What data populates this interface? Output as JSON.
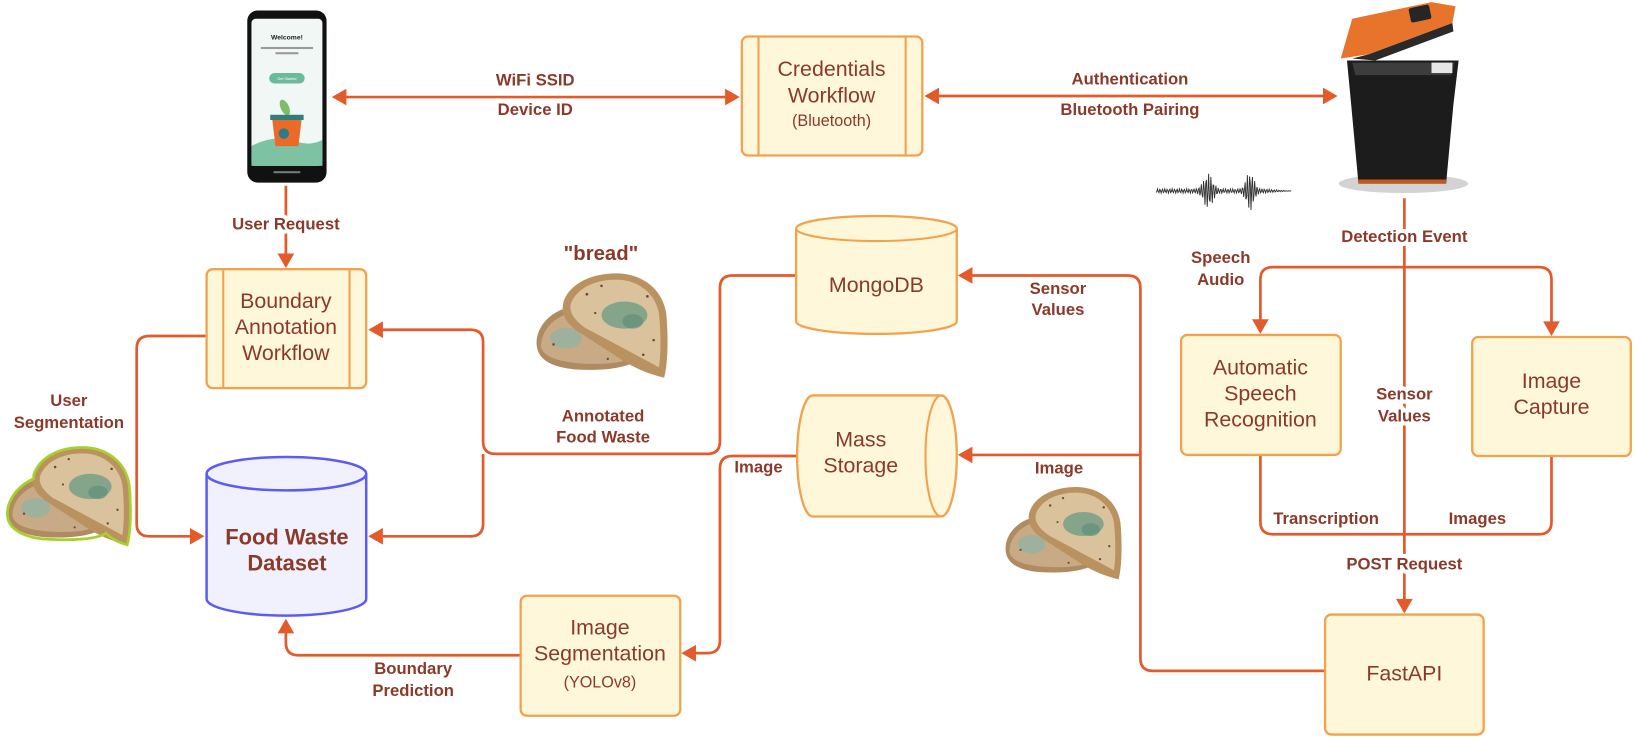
{
  "colors": {
    "connector": "#e35a2b",
    "node_fill": "#fff7d9",
    "node_stroke": "#f3a24c",
    "text": "#8b3a2a",
    "dataset_fill": "#f1f1fd",
    "dataset_stroke": "#5c5cf5"
  },
  "nodes": {
    "credentials_workflow": {
      "shape": "subprocess",
      "lines": [
        "Credentials",
        "Workflow"
      ],
      "subtitle": "(Bluetooth)"
    },
    "boundary_annotation_workflow": {
      "shape": "subprocess",
      "lines": [
        "Boundary",
        "Annotation",
        "Workflow"
      ]
    },
    "food_waste_dataset": {
      "shape": "database",
      "lines": [
        "Food Waste",
        "Dataset"
      ]
    },
    "image_segmentation": {
      "shape": "process",
      "lines": [
        "Image",
        "Segmentation"
      ],
      "subtitle": "(YOLOv8)"
    },
    "mongodb": {
      "shape": "database",
      "lines": [
        "MongoDB"
      ]
    },
    "mass_storage": {
      "shape": "storage",
      "lines": [
        "Mass",
        "Storage"
      ]
    },
    "automatic_speech_recognition": {
      "shape": "process",
      "lines": [
        "Automatic",
        "Speech",
        "Recognition"
      ]
    },
    "image_capture": {
      "shape": "process",
      "lines": [
        "Image",
        "Capture"
      ]
    },
    "fastapi": {
      "shape": "process",
      "lines": [
        "FastAPI"
      ]
    }
  },
  "images": {
    "phone_app": {
      "icon": "smartphone-app",
      "screen_heading": "Welcome!",
      "screen_button": "Get Started"
    },
    "smart_bin": {
      "icon": "smart-bin-device"
    },
    "audio_waveform": {
      "icon": "audio-waveform"
    },
    "annotated_sample": {
      "icon": "moldy-bread-photo",
      "caption": "\"bread\""
    },
    "captured_sample": {
      "icon": "moldy-bread-photo"
    },
    "segmented_sample": {
      "icon": "moldy-bread-segmented-photo"
    }
  },
  "edges": [
    {
      "from": "phone_app",
      "to": "credentials_workflow",
      "bidirectional": true,
      "label_lines": [
        "WiFi SSID",
        "Device ID"
      ]
    },
    {
      "from": "credentials_workflow",
      "to": "smart_bin",
      "bidirectional": true,
      "label_lines": [
        "Authentication",
        "Bluetooth Pairing"
      ]
    },
    {
      "from": "phone_app",
      "to": "boundary_annotation_workflow",
      "label_lines": [
        "User Request"
      ]
    },
    {
      "from": "smart_bin",
      "to": "detection_split",
      "label_lines": [
        "Detection Event"
      ]
    },
    {
      "from": "smart_bin",
      "to": "automatic_speech_recognition",
      "label_lines": [
        "Speech",
        "Audio"
      ]
    },
    {
      "from": "smart_bin",
      "to": "image_capture",
      "label_lines": []
    },
    {
      "from": "smart_bin",
      "to": "fastapi",
      "label_lines": [
        "Sensor",
        "Values"
      ]
    },
    {
      "from": "automatic_speech_recognition",
      "to": "fastapi",
      "label_lines": [
        "Transcription"
      ]
    },
    {
      "from": "image_capture",
      "to": "fastapi",
      "label_lines": [
        "Images"
      ]
    },
    {
      "from": "request_merge",
      "to": "fastapi",
      "label_lines": [
        "POST Request"
      ]
    },
    {
      "from": "fastapi",
      "to": "mongodb",
      "label_lines": [
        "Sensor",
        "Values"
      ]
    },
    {
      "from": "fastapi",
      "to": "mass_storage",
      "label_lines": [
        "Image"
      ]
    },
    {
      "from": "mongodb",
      "to": [
        "boundary_annotation_workflow",
        "food_waste_dataset"
      ],
      "label_lines": [
        "Annotated",
        "Food Waste"
      ]
    },
    {
      "from": "mass_storage",
      "to": "image_segmentation",
      "label_lines": [
        "Image"
      ]
    },
    {
      "from": "image_segmentation",
      "to": "food_waste_dataset",
      "label_lines": [
        "Boundary",
        "Prediction"
      ]
    },
    {
      "from": "boundary_annotation_workflow",
      "to": "food_waste_dataset",
      "label_lines": [
        "User",
        "Segmentation"
      ]
    }
  ]
}
